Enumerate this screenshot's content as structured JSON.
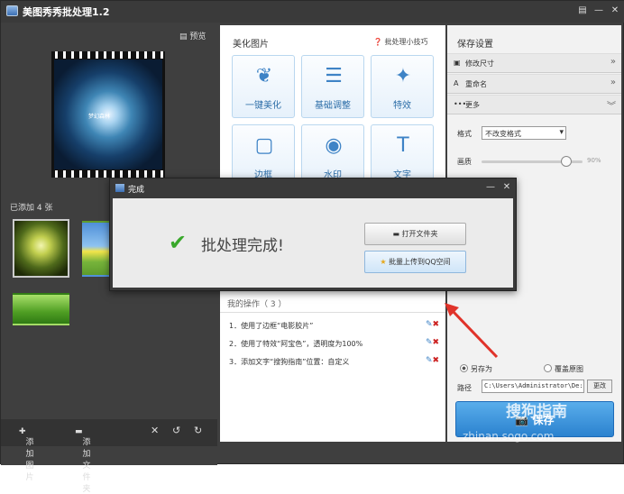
{
  "app": {
    "title": "美图秀秀批处理1.2"
  },
  "left": {
    "preview_label": "预览",
    "film_caption": "梦幻森林",
    "count_label": "已添加 4 张",
    "bottom": {
      "add_image": "添加图片",
      "add_folder": "添加文件夹"
    }
  },
  "middle": {
    "heading": "美化图片",
    "tips": "批处理小技巧",
    "tools": [
      {
        "label": "一键美化",
        "icon": "tulip-icon"
      },
      {
        "label": "基础调整",
        "icon": "sliders-icon"
      },
      {
        "label": "特效",
        "icon": "magic-wand-icon"
      },
      {
        "label": "边框",
        "icon": "frame-icon"
      },
      {
        "label": "水印",
        "icon": "stamp-icon"
      },
      {
        "label": "文字",
        "icon": "text-icon"
      }
    ],
    "ops_heading": "我的操作（ 3 ）",
    "ops": [
      "1．使用了边框“电影胶片”",
      "2．使用了特效“阿宝色”，透明度为100%",
      "3．添加文字“搜狗指南”位置：自定义"
    ]
  },
  "right": {
    "heading": "保存设置",
    "sections": [
      {
        "label": "修改尺寸",
        "icon": "resize-icon",
        "expanded": false
      },
      {
        "label": "重命名",
        "icon": "rename-icon",
        "expanded": false
      },
      {
        "label": "更多",
        "icon": "more-icon",
        "expanded": true
      }
    ],
    "format_label": "格式",
    "format_value": "不改变格式",
    "quality_label": "画质",
    "quality_value": "90%",
    "quality_level": 0.9,
    "save_as": "另存为",
    "overwrite": "覆盖原图",
    "path_label": "路径",
    "path_value": "C:\\Users\\Administrator\\De:",
    "change_btn": "更改",
    "save_btn": "保存"
  },
  "dialog": {
    "title": "完成",
    "message": "批处理完成!",
    "open_folder": "打开文件夹",
    "upload": "批量上传到QQ空间"
  },
  "watermark": {
    "text": "搜狗指南",
    "url": "zhinan.sogo.com"
  },
  "colors": {
    "accent": "#2b82cf",
    "check": "#39a82b",
    "arrow": "#e0332a"
  }
}
